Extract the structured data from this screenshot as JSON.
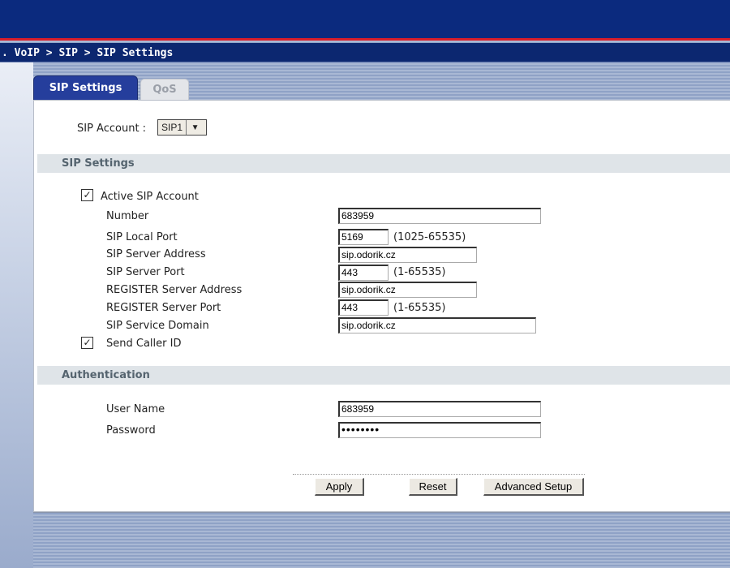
{
  "breadcrumb": ". VoIP > SIP > SIP Settings",
  "tabs": [
    {
      "label": "SIP Settings",
      "active": true
    },
    {
      "label": "QoS",
      "active": false
    }
  ],
  "account": {
    "label": "SIP Account :",
    "selected": "SIP1"
  },
  "sip_settings": {
    "heading": "SIP Settings",
    "active_account": {
      "label": "Active SIP Account",
      "checked": true
    },
    "number": {
      "label": "Number",
      "value": "683959"
    },
    "local_port": {
      "label": "SIP Local Port",
      "value": "5169",
      "hint": "(1025-65535)"
    },
    "server_address": {
      "label": "SIP Server Address",
      "value": "sip.odorik.cz"
    },
    "server_port": {
      "label": "SIP Server Port",
      "value": "443",
      "hint": "(1-65535)"
    },
    "register_address": {
      "label": "REGISTER Server Address",
      "value": "sip.odorik.cz"
    },
    "register_port": {
      "label": "REGISTER Server Port",
      "value": "443",
      "hint": "(1-65535)"
    },
    "service_domain": {
      "label": "SIP Service Domain",
      "value": "sip.odorik.cz"
    },
    "send_caller_id": {
      "label": "Send Caller ID",
      "checked": true
    }
  },
  "authentication": {
    "heading": "Authentication",
    "user_name": {
      "label": "User Name",
      "value": "683959"
    },
    "password": {
      "label": "Password",
      "value": "••••••••"
    }
  },
  "buttons": {
    "apply": "Apply",
    "reset": "Reset",
    "advanced": "Advanced Setup"
  },
  "icons": {
    "dropdown": "chevron-down-icon",
    "check": "checkmark-icon"
  },
  "colors": {
    "banner": "#0b2a7e",
    "accent_red": "#d81e2a",
    "tab_active": "#253e9c",
    "section_bar": "#dfe4e8"
  }
}
